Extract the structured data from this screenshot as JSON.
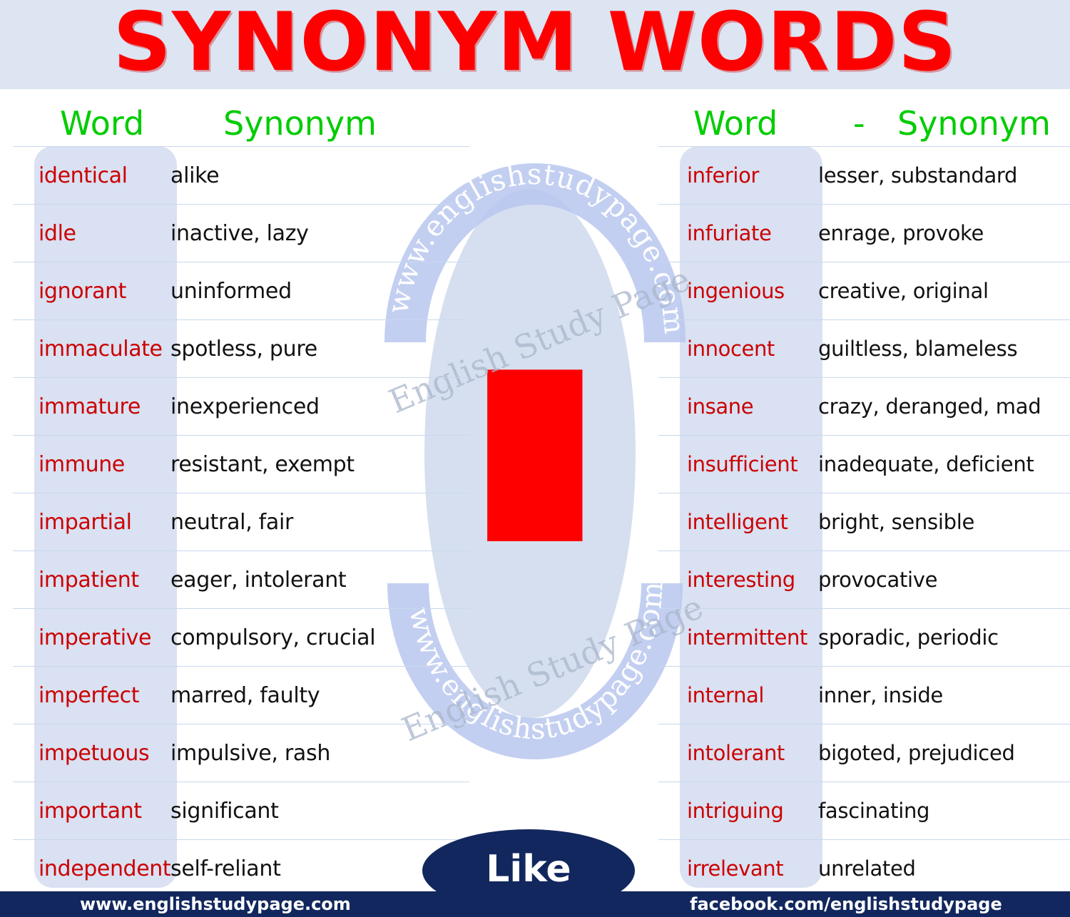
{
  "header": {
    "title": "SYNONYM WORDS",
    "band_color": "#dde4f2",
    "title_color": "#ff0000"
  },
  "columns": {
    "left": {
      "word_label": "Word",
      "synonym_label": "Synonym"
    },
    "right": {
      "word_label": "Word",
      "dash": "-",
      "synonym_label": "Synonym"
    },
    "header_color": "#00cc00",
    "word_color": "#cc0000",
    "synonym_color": "#111111"
  },
  "left_table": [
    {
      "word": "identical",
      "synonym": "alike"
    },
    {
      "word": "idle",
      "synonym": "inactive, lazy"
    },
    {
      "word": "ignorant",
      "synonym": "uninformed"
    },
    {
      "word": "immaculate",
      "synonym": "spotless, pure"
    },
    {
      "word": "immature",
      "synonym": "inexperienced"
    },
    {
      "word": "immune",
      "synonym": "resistant, exempt"
    },
    {
      "word": "impartial",
      "synonym": "neutral, fair"
    },
    {
      "word": "impatient",
      "synonym": "eager, intolerant"
    },
    {
      "word": "imperative",
      "synonym": "compulsory, crucial"
    },
    {
      "word": "imperfect",
      "synonym": "marred, faulty"
    },
    {
      "word": "impetuous",
      "synonym": "impulsive, rash"
    },
    {
      "word": "important",
      "synonym": "significant"
    },
    {
      "word": "independent",
      "synonym": "self-reliant"
    }
  ],
  "right_table": [
    {
      "word": "inferior",
      "synonym": "lesser, substandard"
    },
    {
      "word": "infuriate",
      "synonym": "enrage, provoke"
    },
    {
      "word": "ingenious",
      "synonym": "creative, original"
    },
    {
      "word": "innocent",
      "synonym": "guiltless, blameless"
    },
    {
      "word": "insane",
      "synonym": "crazy, deranged, mad"
    },
    {
      "word": "insufficient",
      "synonym": "inadequate, deficient"
    },
    {
      "word": "intelligent",
      "synonym": "bright, sensible"
    },
    {
      "word": "interesting",
      "synonym": "provocative"
    },
    {
      "word": "intermittent",
      "synonym": "sporadic, periodic"
    },
    {
      "word": "internal",
      "synonym": "inner, inside"
    },
    {
      "word": "intolerant",
      "synonym": "bigoted, prejudiced"
    },
    {
      "word": "intriguing",
      "synonym": "fascinating"
    },
    {
      "word": "irrelevant",
      "synonym": "unrelated"
    }
  ],
  "center": {
    "letter": "I",
    "letter_color": "#ff0000",
    "oval_color": "#d6dff0",
    "watermark_arc_top": "www.englishstudypage.com",
    "watermark_arc_bottom": "www.englishstudypage.com",
    "watermark_diagonal_top": "English Study Page",
    "watermark_diagonal_bottom": "English Study Page"
  },
  "like_badge": {
    "label": "Like",
    "background": "#12275e"
  },
  "footer": {
    "left": "www.englishstudypage.com",
    "right": "facebook.com/englishstudypage",
    "background": "#12275e"
  }
}
